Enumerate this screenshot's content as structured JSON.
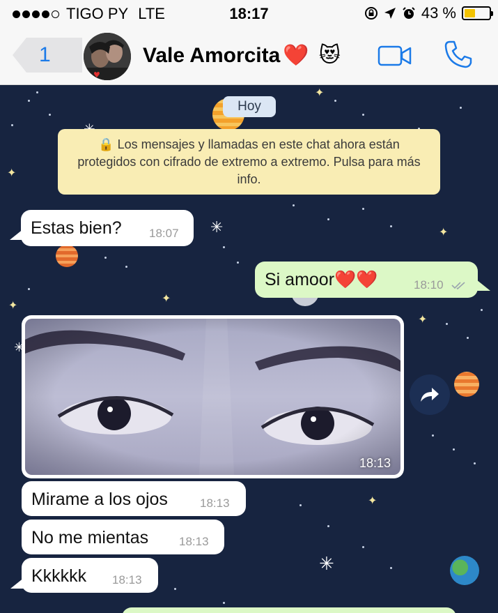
{
  "status_bar": {
    "carrier": "TIGO PY",
    "network": "LTE",
    "time": "18:17",
    "battery": "43 %",
    "battery_level": 0.43,
    "signal_bars": 4
  },
  "header": {
    "back_count": "1",
    "contact_name": "Vale Amorcita",
    "name_emoji": "❤️",
    "status_emoji": "😻",
    "icons": [
      "chevron-left-icon",
      "video-camera-icon",
      "phone-icon"
    ]
  },
  "chat": {
    "date_pill": "Hoy",
    "encryption_notice": "🔒 Los mensajes y llamadas en este chat ahora están protegidos con cifrado de extremo a extremo. Pulsa para más info.",
    "messages": [
      {
        "direction": "in",
        "text": "Estas bien?",
        "time": "18:07"
      },
      {
        "direction": "out",
        "text": "Si amoor❤️❤️",
        "time": "18:10",
        "status": "delivered"
      },
      {
        "direction": "in",
        "type": "image",
        "time": "18:13"
      },
      {
        "direction": "in",
        "text": "Mirame a los ojos",
        "time": "18:13"
      },
      {
        "direction": "in",
        "text": "No me mientas",
        "time": "18:13"
      },
      {
        "direction": "in",
        "text": "Kkkkkk",
        "time": "18:13"
      }
    ]
  },
  "colors": {
    "accent": "#1b7ae8",
    "chat_background": "#172440",
    "incoming_bubble": "#ffffff",
    "outgoing_bubble": "#dcf8c6",
    "notice_background": "#f9edb4",
    "battery_fill": "#f3c300"
  }
}
